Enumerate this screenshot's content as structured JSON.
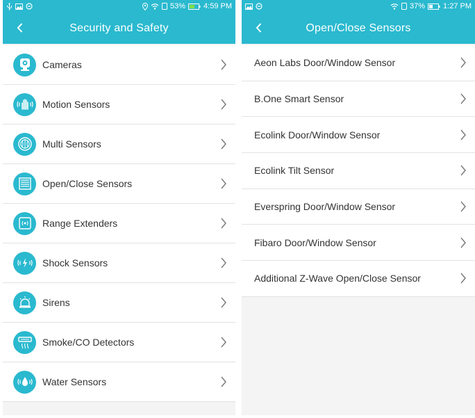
{
  "left": {
    "status": {
      "battery": "53%",
      "time": "4:59 PM"
    },
    "title": "Security and Safety",
    "items": [
      {
        "label": "Cameras"
      },
      {
        "label": "Motion Sensors"
      },
      {
        "label": "Multi Sensors"
      },
      {
        "label": "Open/Close Sensors"
      },
      {
        "label": "Range Extenders"
      },
      {
        "label": "Shock Sensors"
      },
      {
        "label": "Sirens"
      },
      {
        "label": "Smoke/CO Detectors"
      },
      {
        "label": "Water Sensors"
      }
    ]
  },
  "right": {
    "status": {
      "battery": "37%",
      "time": "1:27 PM"
    },
    "title": "Open/Close Sensors",
    "items": [
      {
        "label": "Aeon Labs Door/Window Sensor"
      },
      {
        "label": "B.One Smart Sensor"
      },
      {
        "label": "Ecolink Door/Window Sensor"
      },
      {
        "label": "Ecolink Tilt Sensor"
      },
      {
        "label": "Everspring Door/Window Sensor"
      },
      {
        "label": "Fibaro Door/Window Sensor"
      },
      {
        "label": "Additional Z-Wave Open/Close Sensor"
      }
    ]
  },
  "colors": {
    "accent": "#2ab9cf",
    "text": "#333333",
    "divider": "#e2e2e2",
    "background": "#f4f4f4"
  }
}
